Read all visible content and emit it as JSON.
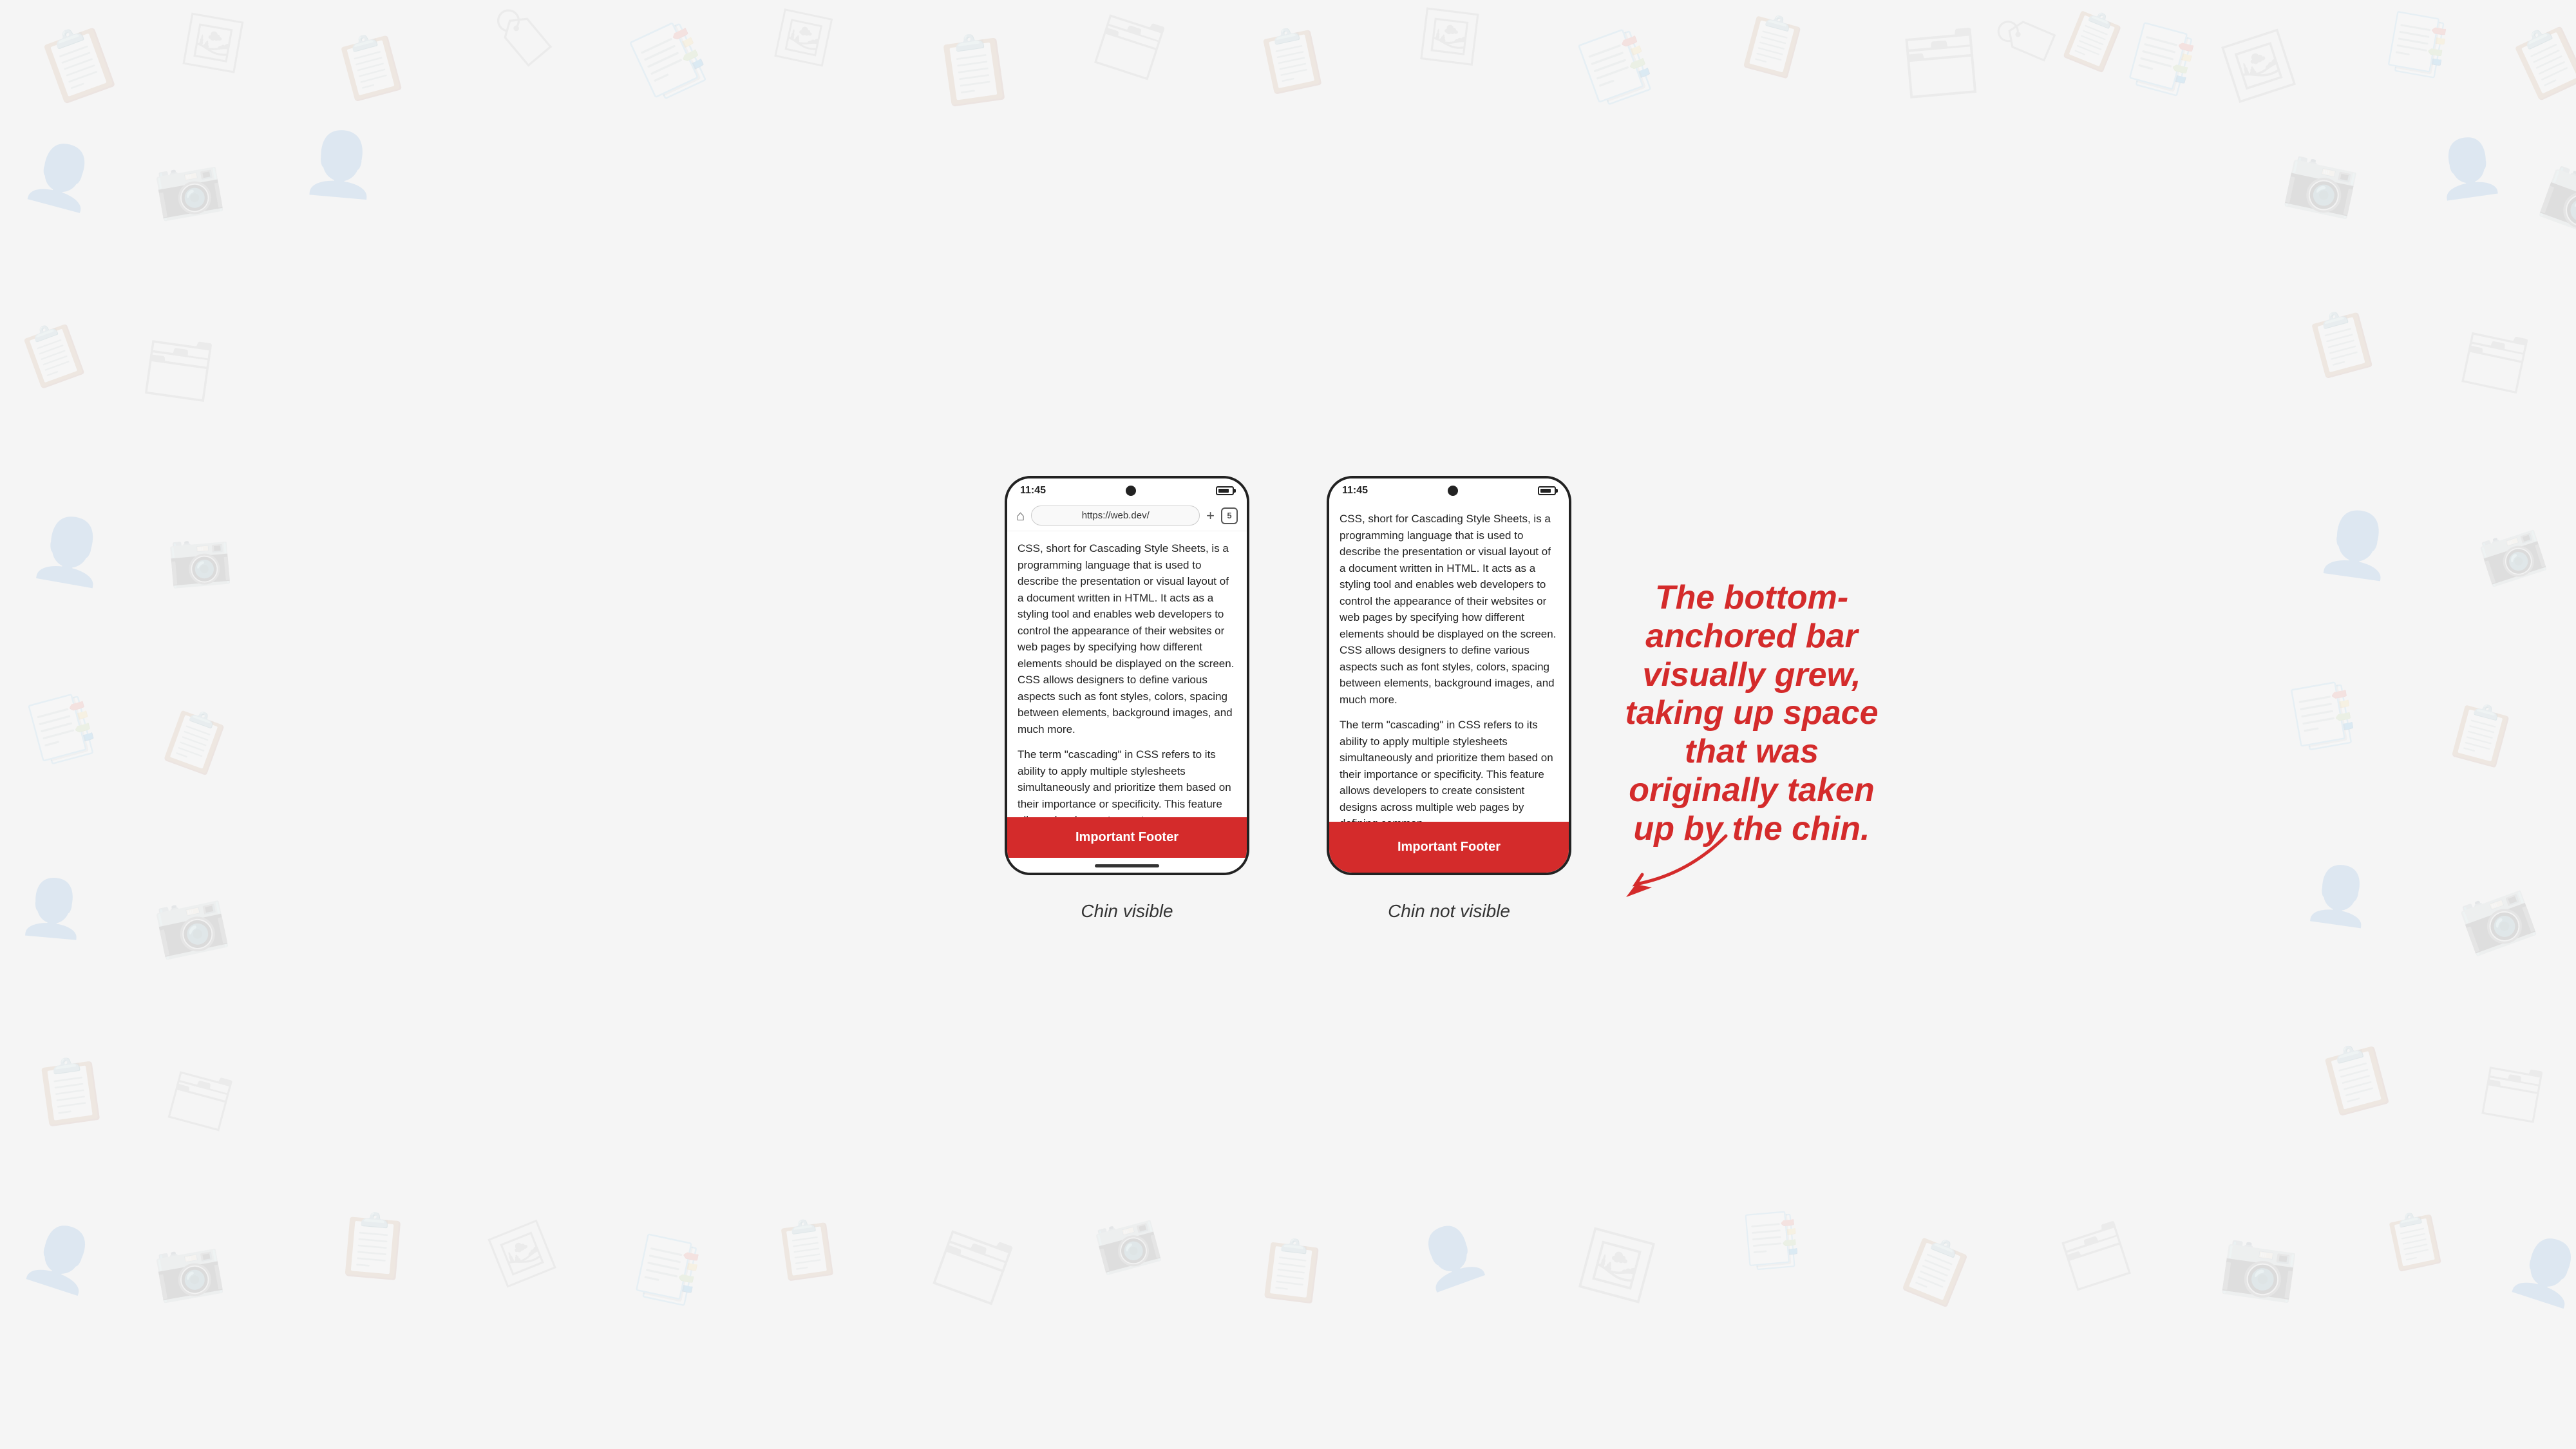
{
  "background": {
    "color": "#f5f5f5"
  },
  "left_phone": {
    "status_bar": {
      "time": "11:45",
      "battery_visible": true
    },
    "address_bar": {
      "url": "https://web.dev/",
      "tabs_count": "5"
    },
    "content": [
      "CSS, short for Cascading Style Sheets, is a programming language that is used to describe the presentation or visual layout of a document written in HTML. It acts as a styling tool and enables web developers to control the appearance of their websites or web pages by specifying how different elements should be displayed on the screen. CSS allows designers to define various aspects such as font styles, colors, spacing between elements, background images, and much more.",
      "The term \"cascading\" in CSS refers to its ability to apply multiple stylesheets simultaneously and prioritize them based on their importance or specificity. This feature allows developers to create"
    ],
    "footer": {
      "label": "Important Footer"
    },
    "chin_visible": true,
    "caption": "Chin visible"
  },
  "right_phone": {
    "status_bar": {
      "time": "11:45",
      "battery_visible": true
    },
    "content": [
      "CSS, short for Cascading Style Sheets, is a programming language that is used to describe the presentation or visual layout of a document written in HTML. It acts as a styling tool and enables web developers to control the appearance of their websites or web pages by specifying how different elements should be displayed on the screen. CSS allows designers to define various aspects such as font styles, colors, spacing between elements, background images, and much more.",
      "The term \"cascading\" in CSS refers to its ability to apply multiple stylesheets simultaneously and prioritize them based on their importance or specificity. This feature allows developers to create consistent designs across multiple web pages by defining common"
    ],
    "footer": {
      "label": "Important Footer"
    },
    "chin_visible": false,
    "caption": "Chin not visible"
  },
  "annotation": {
    "line1": "The bottom-",
    "line2": "anchored bar",
    "line3": "visually grew,",
    "line4": "taking up space",
    "line5": "that was",
    "line6": "originally taken",
    "line7": "up by the chin.",
    "full_text": "The bottom-anchored bar visually grew, taking up space that was originally taken up by the chin."
  }
}
